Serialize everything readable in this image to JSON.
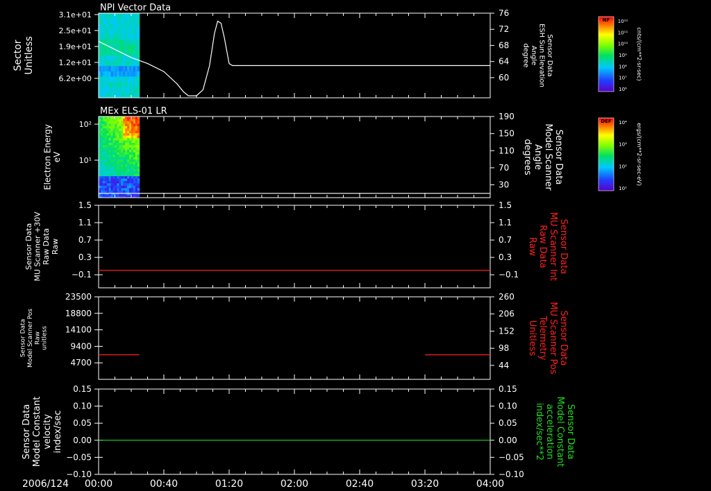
{
  "footer": {
    "date_label": "2006/124"
  },
  "time_axis": {
    "range_minutes": [
      0,
      240
    ],
    "ticks": [
      {
        "min": 0,
        "label": "00:00"
      },
      {
        "min": 40,
        "label": "00:40"
      },
      {
        "min": 80,
        "label": "01:20"
      },
      {
        "min": 120,
        "label": "02:00"
      },
      {
        "min": 160,
        "label": "02:40"
      },
      {
        "min": 200,
        "label": "03:20"
      },
      {
        "min": 240,
        "label": "04:00"
      }
    ]
  },
  "colors": {
    "white": "#ffffff",
    "red": "#ff2020",
    "green": "#22dd22"
  },
  "chart_data": [
    {
      "type": "heatmap",
      "title": "NPI Vector Data",
      "ylabel": [
        "Sector",
        "Unitless"
      ],
      "yticks": [
        "3.1e+01",
        "2.5e+01",
        "1.9e+01",
        "1.2e+01",
        "6.2e+00"
      ],
      "heatmap_time_range": [
        0,
        25
      ],
      "colorbar": {
        "label": "NF",
        "unit": "cnts/(cm**2-sr-sec)",
        "ticks": [
          "10¹²",
          "10¹¹",
          "10¹⁰",
          "10⁹",
          "10⁸",
          "10⁷",
          "10⁶"
        ]
      },
      "overlay": {
        "type": "line",
        "ylabel": [
          "Sensor Data",
          "ESH Sun Elevation",
          "Angle",
          "degree"
        ],
        "ylim": [
          55,
          76
        ],
        "yticks": [
          {
            "v": 76,
            "label": "76"
          },
          {
            "v": 72,
            "label": "72"
          },
          {
            "v": 68,
            "label": "68"
          },
          {
            "v": 64,
            "label": "64"
          },
          {
            "v": 60,
            "label": "60"
          }
        ],
        "x": [
          0,
          10,
          20,
          30,
          40,
          48,
          52,
          55,
          60,
          64,
          68,
          71,
          73,
          75,
          77,
          80,
          82,
          86,
          240
        ],
        "y": [
          69,
          67,
          65,
          63.5,
          61.5,
          58.5,
          56.5,
          55.5,
          55.5,
          57,
          63,
          71,
          74,
          73.5,
          70,
          63.5,
          63,
          63,
          63
        ]
      }
    },
    {
      "type": "heatmap",
      "title": "MEx ELS-01 LR",
      "ylabel": [
        "Electron Energy",
        "eV"
      ],
      "yticks": [
        "10²",
        "10¹"
      ],
      "heatmap_time_range": [
        0,
        25
      ],
      "colorbar": {
        "label": "DEF",
        "unit": "ergs/(cm**2-sr-sec-eV)",
        "ticks": [
          "10⁴",
          "10³",
          "10²",
          "10¹"
        ]
      },
      "overlay": {
        "type": "line",
        "ylabel": [
          "Sensor Data",
          "Model Scanner",
          "Angle",
          "degrees"
        ],
        "ylim": [
          0,
          190
        ],
        "yticks": [
          {
            "v": 190,
            "label": "190"
          },
          {
            "v": 150,
            "label": "150"
          },
          {
            "v": 110,
            "label": "110"
          },
          {
            "v": 70,
            "label": "70"
          },
          {
            "v": 30,
            "label": "30"
          }
        ],
        "x": [
          0,
          240
        ],
        "y": [
          10,
          10
        ]
      }
    },
    {
      "type": "line",
      "ylabel": [
        "Sensor Data",
        "MU Scanner +30V",
        "Raw Data",
        "Raw"
      ],
      "ylim": [
        -0.4,
        1.5
      ],
      "yticks": [
        {
          "v": 1.5,
          "label": "1.5"
        },
        {
          "v": 1.1,
          "label": "1.1"
        },
        {
          "v": 0.7,
          "label": "0.7"
        },
        {
          "v": 0.3,
          "label": "0.3"
        },
        {
          "v": -0.1,
          "label": "−0.1"
        }
      ],
      "right_ylabel": [
        "Sensor Data",
        "MU Scanner Int",
        "Raw Data",
        "Raw"
      ],
      "right_yticks": [
        {
          "v": 1.5,
          "label": "1.5"
        },
        {
          "v": 1.1,
          "label": "1.1"
        },
        {
          "v": 0.7,
          "label": "0.7"
        },
        {
          "v": 0.3,
          "label": "0.3"
        },
        {
          "v": -0.1,
          "label": "−0.1"
        }
      ],
      "series": [
        {
          "x": [
            0,
            240
          ],
          "y": [
            0.0,
            0.0
          ],
          "color": "#ff2020"
        }
      ]
    },
    {
      "type": "line",
      "ylabel": [
        "Sensor Data",
        "Model Scanner Pos",
        "Raw",
        "unitless"
      ],
      "ylim": [
        0,
        23500
      ],
      "yticks": [
        {
          "v": 23500,
          "label": "23500"
        },
        {
          "v": 18800,
          "label": "18800"
        },
        {
          "v": 14100,
          "label": "14100"
        },
        {
          "v": 9400,
          "label": "9400"
        },
        {
          "v": 4700,
          "label": "4700"
        }
      ],
      "right_ylabel": [
        "Sensor Data",
        "MU Scanner Pos",
        "Telemetry",
        "Unitless"
      ],
      "right_yticks": [
        {
          "v": 23500,
          "label": "260"
        },
        {
          "v": 18614,
          "label": "206"
        },
        {
          "v": 13734,
          "label": "152"
        },
        {
          "v": 8854,
          "label": "98"
        },
        {
          "v": 3974,
          "label": "44"
        }
      ],
      "series": [
        {
          "x": [
            0,
            25
          ],
          "y": [
            7000,
            7000
          ],
          "color": "#ff2020"
        },
        {
          "x": [
            200,
            240
          ],
          "y": [
            7000,
            7000
          ],
          "color": "#ff2020"
        }
      ]
    },
    {
      "type": "line",
      "ylabel": [
        "Sensor Data",
        "Model Constant",
        "velocity",
        "index/sec"
      ],
      "ylim": [
        -0.1,
        0.15
      ],
      "yticks": [
        {
          "v": 0.15,
          "label": "0.15"
        },
        {
          "v": 0.1,
          "label": "0.10"
        },
        {
          "v": 0.05,
          "label": "0.05"
        },
        {
          "v": 0,
          "label": "0.00"
        },
        {
          "v": -0.05,
          "label": "−0.05"
        },
        {
          "v": -0.1,
          "label": "−0.10"
        }
      ],
      "right_ylabel": [
        "Sensor Data",
        "Model Constant",
        "acceleration",
        "index/sec**2"
      ],
      "right_yticks": [
        {
          "v": 0.15,
          "label": "0.15"
        },
        {
          "v": 0.1,
          "label": "0.10"
        },
        {
          "v": 0.05,
          "label": "0.05"
        },
        {
          "v": 0,
          "label": "0.00"
        },
        {
          "v": -0.05,
          "label": "−0.05"
        },
        {
          "v": -0.1,
          "label": "−0.10"
        }
      ],
      "series": [
        {
          "x": [
            0,
            240
          ],
          "y": [
            0,
            0
          ],
          "color": "#22dd22"
        }
      ]
    }
  ]
}
